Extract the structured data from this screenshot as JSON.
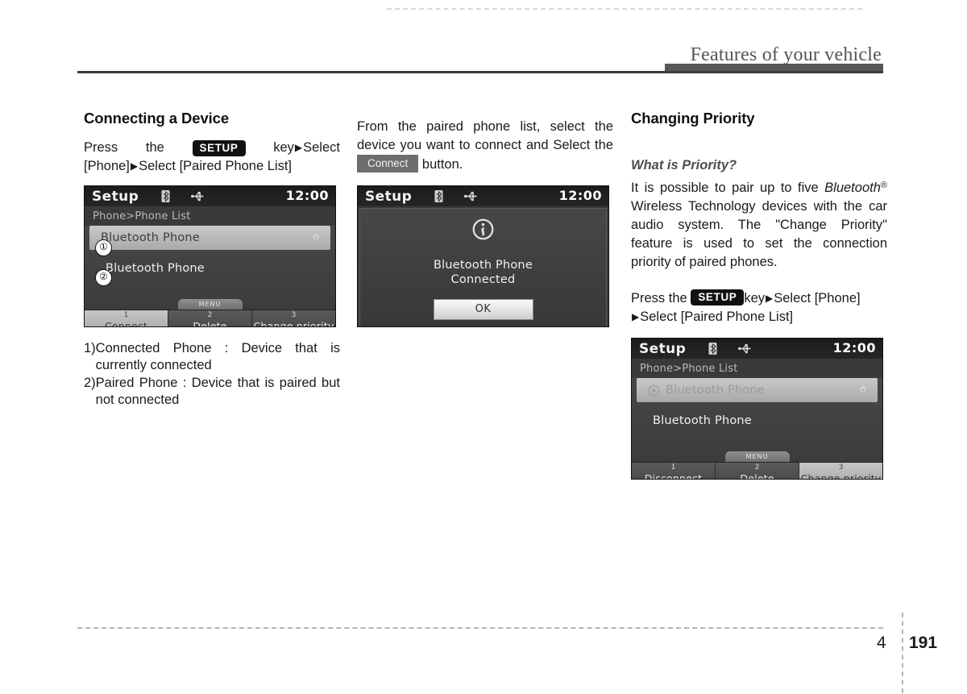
{
  "header": {
    "title": "Features of your vehicle"
  },
  "footer": {
    "chapter": "4",
    "page": "191"
  },
  "left_column": {
    "section_title": "Connecting a Device",
    "instruction": {
      "press": "Press",
      "the": "the",
      "setup_key": "SETUP",
      "key_word": "key",
      "arrow": "▶",
      "select_1": "Select",
      "phone_bracket": "[Phone]",
      "select_2": "Select",
      "paired_list_bracket": "[Paired Phone List]"
    },
    "screen": {
      "title": "Setup",
      "clock": "12:00",
      "breadcrumb": "Phone>Phone List",
      "rows": [
        {
          "label": "Bluetooth Phone",
          "state": "selected",
          "callout": "①"
        },
        {
          "label": "Bluetooth Phone",
          "state": "normal",
          "callout": "②"
        }
      ],
      "menu_tab": "MENU",
      "softkeys": [
        {
          "num": "1",
          "label": "Connect",
          "highlighted": true
        },
        {
          "num": "2",
          "label": "Delete",
          "highlighted": false
        },
        {
          "num": "3",
          "label": "Change priority",
          "highlighted": false
        }
      ]
    },
    "notes": [
      {
        "num": "1)",
        "text": "Connected Phone : Device that is currently connected"
      },
      {
        "num": "2)",
        "text": "Paired Phone : Device that is paired but not connected"
      }
    ]
  },
  "middle_column": {
    "paragraph_part1": "From the paired phone list, select the device you want to connect and Select the",
    "connect_key": "Connect",
    "paragraph_part2": "button.",
    "screen": {
      "title": "Setup",
      "clock": "12:00",
      "icon": "info-icon",
      "message_line1": "Bluetooth Phone",
      "message_line2": "Connected",
      "ok_label": "OK"
    }
  },
  "right_column": {
    "section_title": "Changing Priority",
    "subtitle": "What is Priority?",
    "paragraph_pre": "It is possible to pair up to five ",
    "bluetooth_word": "Bluetooth",
    "registered_mark": "®",
    "paragraph_post": " Wireless Technology devices with the car audio system. The \"Change Priority\" feature is used to set the connection priority of paired phones.",
    "instruction": {
      "press": "Press",
      "the": "the",
      "setup_key": "SETUP",
      "key_word": "key",
      "arrow": "▶",
      "select_1": "Select",
      "phone_bracket": "[Phone]",
      "select_2": "Select",
      "paired_list_bracket": "[Paired Phone List]"
    },
    "screen": {
      "title": "Setup",
      "clock": "12:00",
      "breadcrumb": "Phone>Phone List",
      "rows": [
        {
          "label": "Bluetooth Phone",
          "state": "selected-dim",
          "icon": "play-icon"
        },
        {
          "label": "Bluetooth Phone",
          "state": "normal"
        }
      ],
      "menu_tab": "MENU",
      "softkeys": [
        {
          "num": "1",
          "label": "Disconnect",
          "highlighted": false
        },
        {
          "num": "2",
          "label": "Delete",
          "highlighted": false
        },
        {
          "num": "3",
          "label": "Change priority",
          "highlighted": true
        }
      ]
    }
  }
}
